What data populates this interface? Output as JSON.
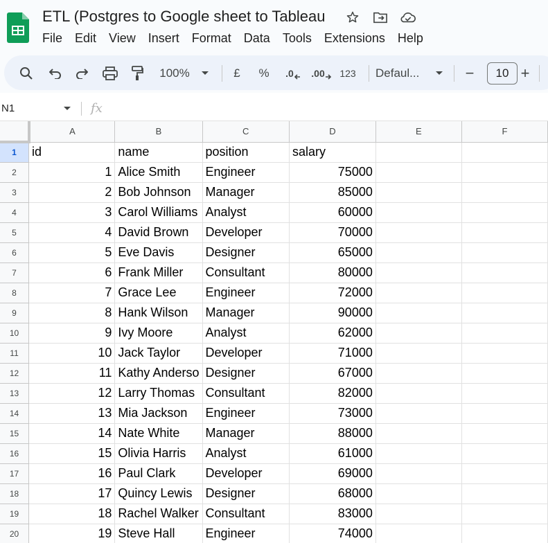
{
  "document": {
    "title": "ETL (Postgres to Google sheet to Tableau"
  },
  "menu": [
    "File",
    "Edit",
    "View",
    "Insert",
    "Format",
    "Data",
    "Tools",
    "Extensions",
    "Help"
  ],
  "toolbar": {
    "zoom": "100%",
    "currency": "£",
    "percent": "%",
    "decrease_decimal": ".0",
    "increase_decimal": ".00",
    "number_format": "123",
    "font": "Defaul...",
    "font_size": "10",
    "minus": "−",
    "plus": "+"
  },
  "formula_bar": {
    "cell_ref": "N1",
    "fx": "fx"
  },
  "columns": [
    "A",
    "B",
    "C",
    "D",
    "E",
    "F"
  ],
  "rows": [
    {
      "num": "1",
      "id": "id",
      "name": "name",
      "position": "position",
      "salary": "salary"
    },
    {
      "num": "2",
      "id": "1",
      "name": "Alice Smith",
      "position": "Engineer",
      "salary": "75000"
    },
    {
      "num": "3",
      "id": "2",
      "name": "Bob Johnson",
      "position": "Manager",
      "salary": "85000"
    },
    {
      "num": "4",
      "id": "3",
      "name": "Carol Williams",
      "position": "Analyst",
      "salary": "60000"
    },
    {
      "num": "5",
      "id": "4",
      "name": "David Brown",
      "position": "Developer",
      "salary": "70000"
    },
    {
      "num": "6",
      "id": "5",
      "name": "Eve Davis",
      "position": "Designer",
      "salary": "65000"
    },
    {
      "num": "7",
      "id": "6",
      "name": "Frank Miller",
      "position": "Consultant",
      "salary": "80000"
    },
    {
      "num": "8",
      "id": "7",
      "name": "Grace Lee",
      "position": "Engineer",
      "salary": "72000"
    },
    {
      "num": "9",
      "id": "8",
      "name": "Hank Wilson",
      "position": "Manager",
      "salary": "90000"
    },
    {
      "num": "10",
      "id": "9",
      "name": "Ivy Moore",
      "position": "Analyst",
      "salary": "62000"
    },
    {
      "num": "11",
      "id": "10",
      "name": "Jack Taylor",
      "position": "Developer",
      "salary": "71000"
    },
    {
      "num": "12",
      "id": "11",
      "name": "Kathy Anderso",
      "position": "Designer",
      "salary": "67000"
    },
    {
      "num": "13",
      "id": "12",
      "name": "Larry Thomas",
      "position": "Consultant",
      "salary": "82000"
    },
    {
      "num": "14",
      "id": "13",
      "name": "Mia Jackson",
      "position": "Engineer",
      "salary": "73000"
    },
    {
      "num": "15",
      "id": "14",
      "name": "Nate White",
      "position": "Manager",
      "salary": "88000"
    },
    {
      "num": "16",
      "id": "15",
      "name": "Olivia Harris",
      "position": "Analyst",
      "salary": "61000"
    },
    {
      "num": "17",
      "id": "16",
      "name": "Paul Clark",
      "position": "Developer",
      "salary": "69000"
    },
    {
      "num": "18",
      "id": "17",
      "name": "Quincy Lewis",
      "position": "Designer",
      "salary": "68000"
    },
    {
      "num": "19",
      "id": "18",
      "name": "Rachel Walker",
      "position": "Consultant",
      "salary": "83000"
    },
    {
      "num": "20",
      "id": "19",
      "name": "Steve Hall",
      "position": "Engineer",
      "salary": "74000"
    }
  ],
  "colors": {
    "sheets_green": "#0f9d58",
    "selected_row_header": "#d3e3fd",
    "accent_blue": "#0b57d0"
  }
}
